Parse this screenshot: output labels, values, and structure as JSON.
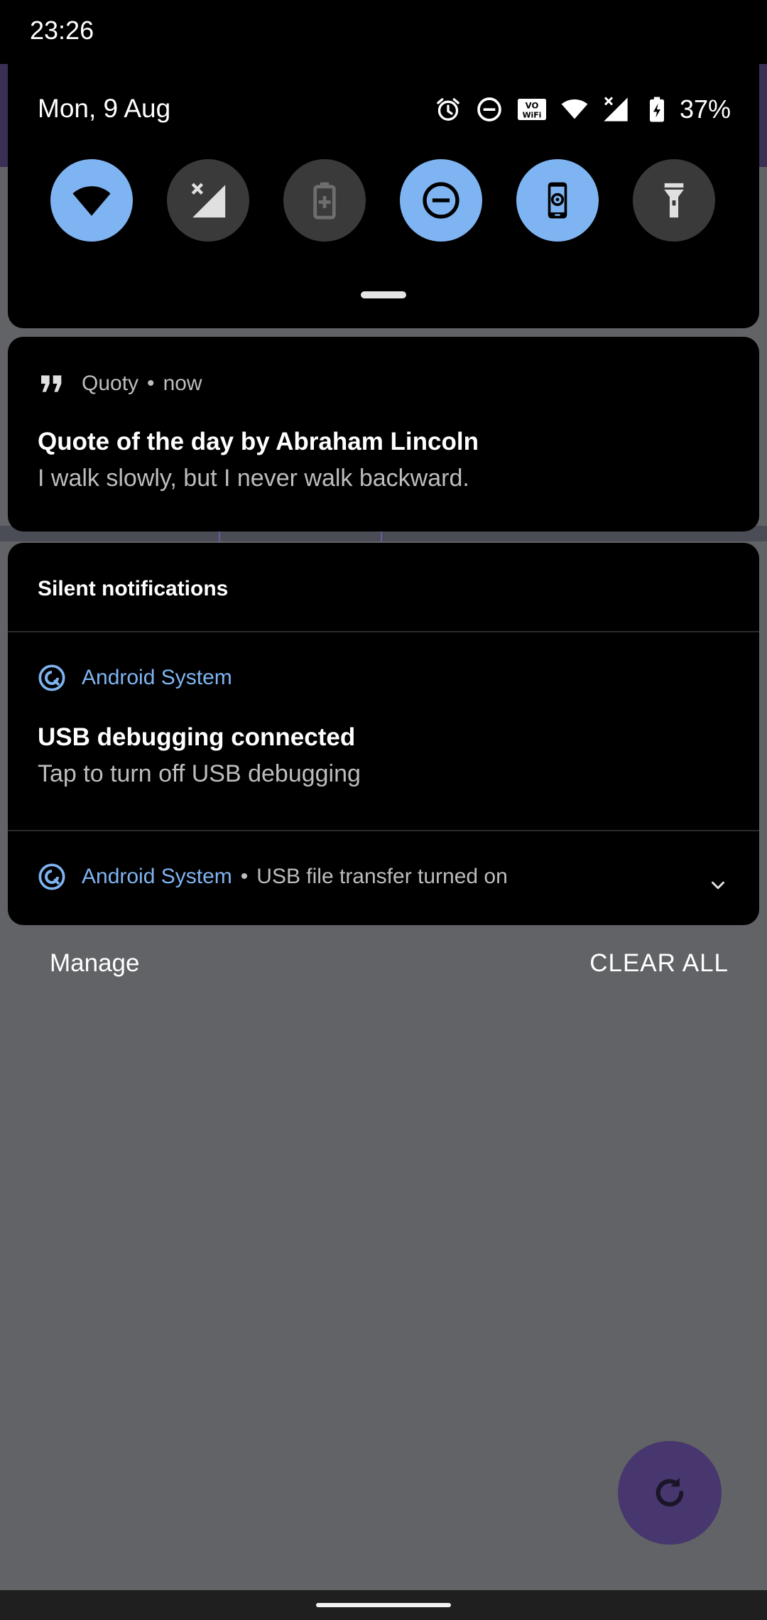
{
  "status_bar": {
    "time": "23:26"
  },
  "quick_settings": {
    "date": "Mon, 9 Aug",
    "battery_percent": "37%",
    "status_icons": [
      "alarm-icon",
      "do-not-disturb-icon",
      "vowifi-icon",
      "wifi-icon",
      "signal-no-service-icon",
      "battery-charging-icon"
    ],
    "tiles": [
      {
        "name": "wifi",
        "icon": "wifi-icon",
        "state": "on"
      },
      {
        "name": "mobile-data",
        "icon": "mobile-data-off-icon",
        "state": "off"
      },
      {
        "name": "battery-saver",
        "icon": "battery-saver-icon",
        "state": "off"
      },
      {
        "name": "do-not-disturb",
        "icon": "do-not-disturb-icon",
        "state": "on"
      },
      {
        "name": "auto-rotate",
        "icon": "screen-rotate-icon",
        "state": "on"
      },
      {
        "name": "flashlight",
        "icon": "flashlight-icon",
        "state": "off"
      }
    ],
    "colors": {
      "tile_on": "#7fb4f2",
      "tile_off": "#3a3a3a"
    }
  },
  "quoty_notification": {
    "app_name": "Quoty",
    "app_icon": "quote-icon",
    "time": "now",
    "title": "Quote of the day by Abraham Lincoln",
    "text": "I walk slowly, but I never walk backward."
  },
  "silent_section": {
    "title": "Silent notifications",
    "notifications": [
      {
        "app_name": "Android System",
        "app_icon": "android-system-icon",
        "title": "USB debugging connected",
        "text": "Tap to turn off USB debugging"
      },
      {
        "app_name": "Android System",
        "app_icon": "android-system-icon",
        "summary": "USB file transfer turned on"
      }
    ]
  },
  "actions": {
    "manage": "Manage",
    "clear_all": "CLEAR ALL"
  },
  "fab": {
    "icon": "refresh-icon"
  },
  "colors": {
    "accent_blue": "#7fb4f2",
    "scrim": "#626366",
    "fab_purple": "#47376e"
  }
}
